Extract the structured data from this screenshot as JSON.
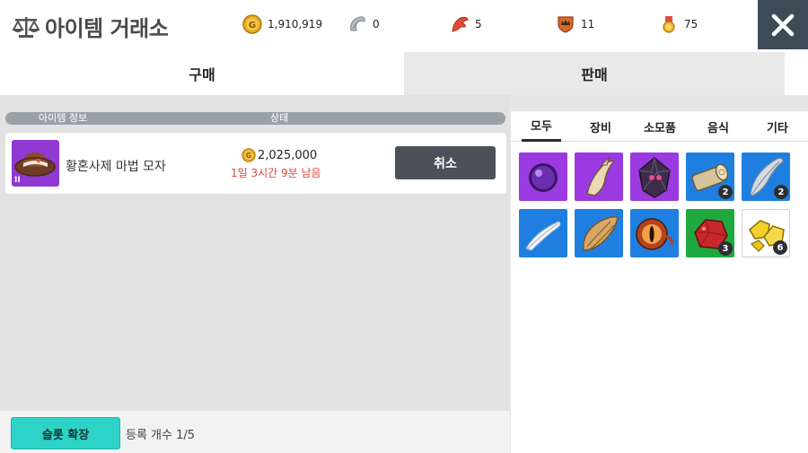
{
  "header": {
    "title": "아이템 거래소",
    "close_icon": "close-icon",
    "currencies": [
      {
        "name": "gold-coin-icon",
        "value": "1,910,919"
      },
      {
        "name": "silver-leaf-icon",
        "value": "0"
      },
      {
        "name": "red-feather-icon",
        "value": "5"
      },
      {
        "name": "crown-shield-icon",
        "value": "11"
      },
      {
        "name": "medal-icon",
        "value": "75"
      }
    ]
  },
  "tabs": {
    "buy": "구매",
    "sell": "판매"
  },
  "list": {
    "col_item_info": "아이템 정보",
    "col_status": "상태",
    "rows": [
      {
        "item_name": "황혼사제 마법 모자",
        "price": "2,025,000",
        "time_left": "1일 3시간 9분  남음",
        "cancel_label": "취소",
        "thumb_icon": "wizard-hat-icon",
        "thumb_badge": "II"
      }
    ]
  },
  "footer": {
    "expand_label": "슬롯 확장",
    "reg_count": "등록 개수 1/5"
  },
  "categories": [
    "모두",
    "장비",
    "소모품",
    "음식",
    "기타"
  ],
  "active_category": "모두",
  "inventory": [
    {
      "icon": "purple-orb-icon",
      "bg": "purple",
      "count": ""
    },
    {
      "icon": "claw-icon",
      "bg": "purple",
      "count": ""
    },
    {
      "icon": "dark-crystal-icon",
      "bg": "purple",
      "count": ""
    },
    {
      "icon": "log-icon",
      "bg": "blue",
      "count": "2"
    },
    {
      "icon": "silver-feather-icon",
      "bg": "blue",
      "count": "2"
    },
    {
      "icon": "white-feather-icon",
      "bg": "blue",
      "count": ""
    },
    {
      "icon": "wing-icon",
      "bg": "blue",
      "count": ""
    },
    {
      "icon": "eye-icon",
      "bg": "blue",
      "count": ""
    },
    {
      "icon": "red-ore-icon",
      "bg": "green",
      "count": "3"
    },
    {
      "icon": "gold-ore-icon",
      "bg": "white",
      "count": "6"
    }
  ],
  "colors": {
    "accent_teal": "#2ed3c8",
    "close_bg": "#3e4b57",
    "time_red": "#e0463b",
    "rarity_purple": "#9a3ae0",
    "rarity_blue": "#1e7fe0",
    "rarity_green": "#1fa83e"
  }
}
